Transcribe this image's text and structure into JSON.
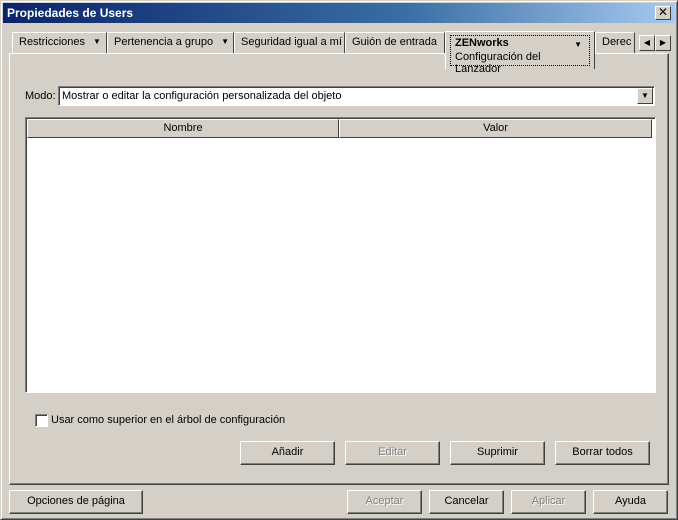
{
  "window": {
    "title": "Propiedades de Users",
    "close_label": "✕"
  },
  "tabs": [
    {
      "label": "Restricciones",
      "has_dropdown": true
    },
    {
      "label": "Pertenencia a grupo",
      "has_dropdown": true
    },
    {
      "label": "Seguridad igual a mí",
      "has_dropdown": false
    },
    {
      "label": "Guión de entrada",
      "has_dropdown": false
    },
    {
      "label": "ZENworks",
      "sublabel": "Configuración del Lanzador",
      "has_dropdown": true,
      "active": true
    },
    {
      "label": "Derec",
      "has_dropdown": false
    }
  ],
  "tab_scroll": {
    "left": "◀",
    "right": "▶"
  },
  "mode": {
    "label": "Modo:",
    "value": "Mostrar o editar la configuración personalizada del objeto"
  },
  "table": {
    "columns": [
      "Nombre",
      "Valor"
    ],
    "rows": []
  },
  "checkbox": {
    "label": "Usar como superior en el árbol de configuración",
    "checked": false
  },
  "actions": {
    "add": "Añadir",
    "edit": "Editar",
    "delete": "Suprimir",
    "clear_all": "Borrar todos"
  },
  "footer": {
    "page_options": "Opciones de página",
    "accept": "Aceptar",
    "cancel": "Cancelar",
    "apply": "Aplicar",
    "help": "Ayuda"
  },
  "icons": {
    "dropdown": "▼"
  }
}
